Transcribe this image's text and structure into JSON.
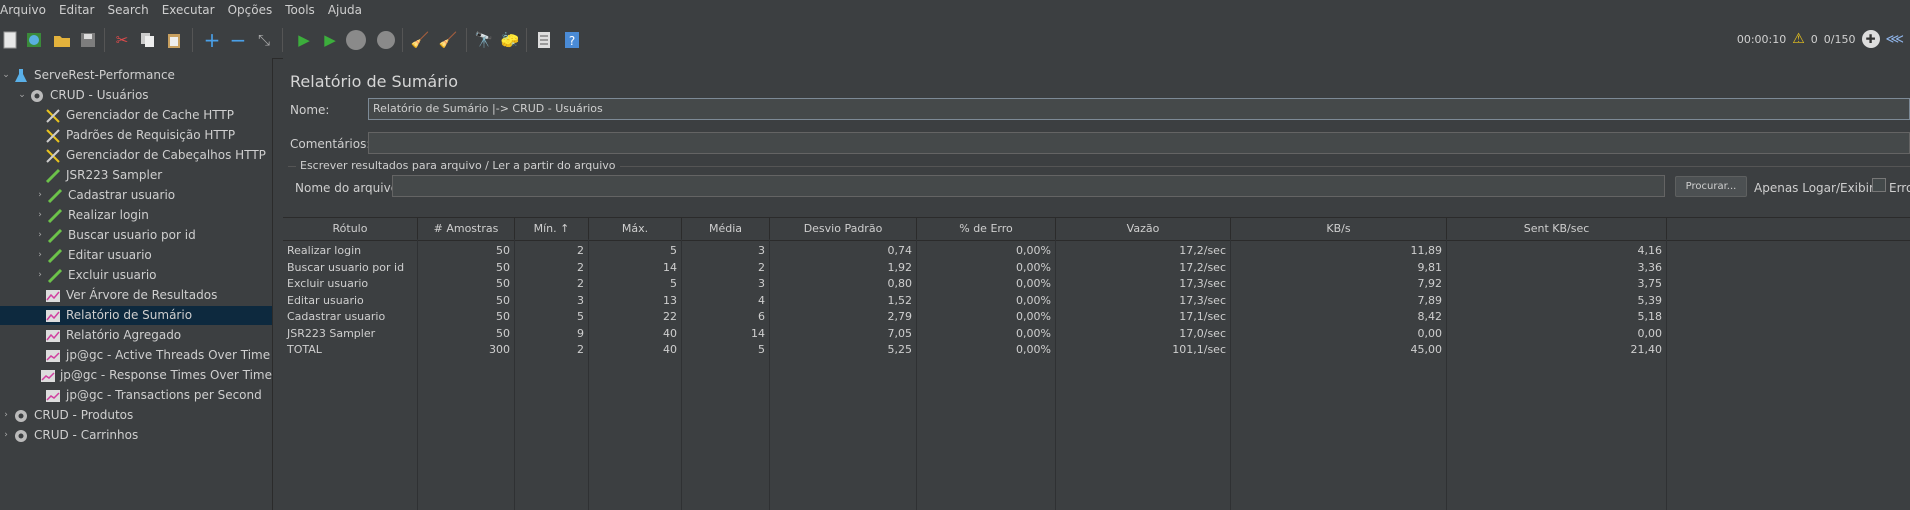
{
  "menu": [
    "Arquivo",
    "Editar",
    "Search",
    "Executar",
    "Opções",
    "Tools",
    "Ajuda"
  ],
  "toolbar": {
    "icons": [
      "new-icon",
      "templates-icon",
      "open-icon",
      "save-icon",
      "cut-icon",
      "copy-icon",
      "paste-icon",
      "expand-icon",
      "collapse-icon",
      "toggle-icon",
      "start-icon",
      "start-no-pause-icon",
      "stop-icon",
      "shutdown-icon",
      "clear-icon",
      "clear-all-icon",
      "search-icon",
      "reset-search-icon",
      "function-helper-icon",
      "help-icon"
    ],
    "timer": "00:00:10",
    "warnings": "0",
    "threads": "0/150",
    "colors": {
      "start": "#3cae3c",
      "warning": "#e8c31e",
      "help": "#4a8bd6"
    }
  },
  "tree": {
    "items": [
      {
        "label": "ServeRest-Performance",
        "icon": "test-plan-icon",
        "arrow": "⌄"
      },
      {
        "label": "CRUD - Usuários",
        "icon": "thread-group-icon",
        "arrow": "⌄"
      },
      {
        "label": "Gerenciador de Cache HTTP",
        "icon": "config-tool-icon",
        "arrow": ""
      },
      {
        "label": "Padrões de Requisição HTTP",
        "icon": "config-tool-icon",
        "arrow": ""
      },
      {
        "label": "Gerenciador de Cabeçalhos HTTP",
        "icon": "config-tool-icon",
        "arrow": ""
      },
      {
        "label": "JSR223 Sampler",
        "icon": "sampler-icon",
        "arrow": ""
      },
      {
        "label": "Cadastrar usuario",
        "icon": "sampler-icon",
        "arrow": "›"
      },
      {
        "label": "Realizar login",
        "icon": "sampler-icon",
        "arrow": "›"
      },
      {
        "label": "Buscar usuario por id",
        "icon": "sampler-icon",
        "arrow": "›"
      },
      {
        "label": "Editar usuario",
        "icon": "sampler-icon",
        "arrow": "›"
      },
      {
        "label": "Excluir usuario",
        "icon": "sampler-icon",
        "arrow": "›"
      },
      {
        "label": "Ver Árvore de Resultados",
        "icon": "listener-icon",
        "arrow": ""
      },
      {
        "label": "Relatório de Sumário",
        "icon": "listener-icon",
        "arrow": ""
      },
      {
        "label": "Relatório Agregado",
        "icon": "listener-icon",
        "arrow": ""
      },
      {
        "label": "jp@gc - Active Threads Over Time",
        "icon": "graph-icon",
        "arrow": ""
      },
      {
        "label": "jp@gc - Response Times Over Time",
        "icon": "graph-icon",
        "arrow": ""
      },
      {
        "label": "jp@gc - Transactions per Second",
        "icon": "graph-icon",
        "arrow": ""
      },
      {
        "label": "CRUD - Produtos",
        "icon": "thread-group-icon",
        "arrow": "›"
      },
      {
        "label": "CRUD - Carrinhos",
        "icon": "thread-group-icon",
        "arrow": "›"
      }
    ]
  },
  "panel": {
    "title": "Relatório de Sumário",
    "name_label": "Nome:",
    "name_value": "Relatório de Sumário |-> CRUD - Usuários",
    "comments_label": "Comentários:",
    "comments_value": "",
    "fieldset_title": "Escrever resultados para arquivo / Ler a partir do arquivo",
    "filename_label": "Nome do arquivo",
    "filename_value": "",
    "browse_label": "Procurar...",
    "log_only_label": "Apenas Logar/Exibir",
    "errors_label": "Erros"
  },
  "table": {
    "columns": [
      "Rótulo",
      "# Amostras",
      "Mín. ↑",
      "Máx.",
      "Média",
      "Desvio Padrão",
      "% de Erro",
      "Vazão",
      "KB/s",
      "Sent KB/sec"
    ],
    "rows": [
      [
        "Realizar login",
        "50",
        "2",
        "5",
        "3",
        "0,74",
        "0,00%",
        "17,2/sec",
        "11,89",
        "4,16"
      ],
      [
        "Buscar usuario por id",
        "50",
        "2",
        "14",
        "2",
        "1,92",
        "0,00%",
        "17,2/sec",
        "9,81",
        "3,36"
      ],
      [
        "Excluir usuario",
        "50",
        "2",
        "5",
        "3",
        "0,80",
        "0,00%",
        "17,3/sec",
        "7,92",
        "3,75"
      ],
      [
        "Editar usuario",
        "50",
        "3",
        "13",
        "4",
        "1,52",
        "0,00%",
        "17,3/sec",
        "7,89",
        "5,39"
      ],
      [
        "Cadastrar usuario",
        "50",
        "5",
        "22",
        "6",
        "2,79",
        "0,00%",
        "17,1/sec",
        "8,42",
        "5,18"
      ],
      [
        "JSR223 Sampler",
        "50",
        "9",
        "40",
        "14",
        "7,05",
        "0,00%",
        "17,0/sec",
        "0,00",
        "0,00"
      ],
      [
        "TOTAL",
        "300",
        "2",
        "40",
        "5",
        "5,25",
        "0,00%",
        "101,1/sec",
        "45,00",
        "21,40"
      ]
    ]
  }
}
